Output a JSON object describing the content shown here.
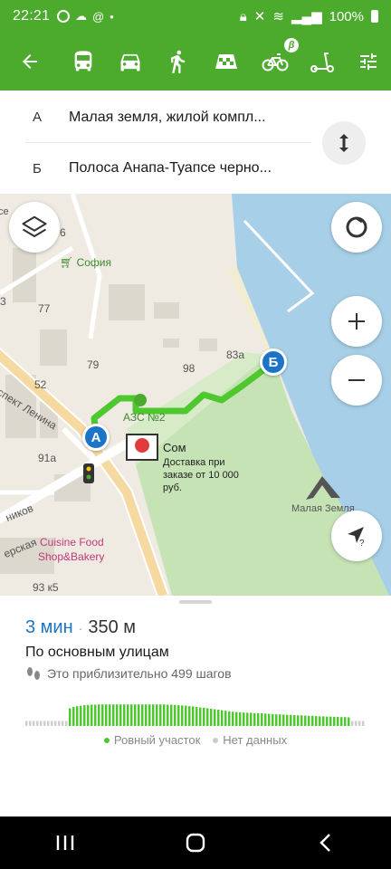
{
  "status_bar": {
    "time": "22:21",
    "battery": "100%"
  },
  "modes": [
    {
      "name": "car-mode-back",
      "icon": "back-arrow-icon"
    },
    {
      "name": "bus-mode",
      "icon": "bus-icon"
    },
    {
      "name": "car-mode",
      "icon": "car-icon"
    },
    {
      "name": "walk-mode",
      "icon": "walk-icon"
    },
    {
      "name": "taxi-mode",
      "icon": "taxi-icon"
    },
    {
      "name": "bike-mode",
      "icon": "bike-icon"
    },
    {
      "name": "scooter-mode",
      "icon": "scooter-icon"
    },
    {
      "name": "settings",
      "icon": "sliders-icon"
    }
  ],
  "colors": {
    "brand": "#4caa2c",
    "route": "#4fc72e",
    "pin": "#1b74c8",
    "water": "#a7d0e8"
  },
  "route": {
    "from_letter": "А",
    "from_address": "Малая земля, жилой компл...",
    "to_letter": "Б",
    "to_address": "Полоса Анапа-Туапсе черно..."
  },
  "map": {
    "labels": {
      "sofia": "София",
      "n77": "77",
      "n79": "79",
      "n98": "98",
      "n83a": "83а",
      "n52": "52",
      "n91a": "91а",
      "n3": "3",
      "n6": "6",
      "street_lenina": "спект Ленина",
      "azs": "АЗС №2",
      "som_title": "Сом",
      "som_desc_1": "Доставка при",
      "som_desc_2": "заказе от 10 000",
      "som_desc_3": "руб.",
      "cuisine_1": "Cuisine Food",
      "cuisine_2": "Shop&Bakery",
      "malaya_zemlya": "Малая Земля",
      "n93k5": "93 к5",
      "nikov": "ников",
      "erskaya": "ерская",
      "se": "се"
    },
    "pin_a": "А",
    "pin_b": "Б"
  },
  "summary": {
    "time": "3 мин",
    "separator": "·",
    "distance": "350 м",
    "route_type": "По основным улицам",
    "steps": "Это приблизительно 499 шагов"
  },
  "elevation": {
    "bars": [
      0.2,
      0.2,
      0.2,
      0.2,
      0.2,
      0.2,
      0.2,
      0.2,
      0.2,
      0.2,
      0.2,
      0.2,
      0.7,
      0.75,
      0.78,
      0.8,
      0.82,
      0.83,
      0.84,
      0.84,
      0.85,
      0.85,
      0.85,
      0.85,
      0.85,
      0.85,
      0.85,
      0.85,
      0.85,
      0.85,
      0.85,
      0.85,
      0.85,
      0.85,
      0.85,
      0.85,
      0.85,
      0.85,
      0.85,
      0.84,
      0.84,
      0.83,
      0.82,
      0.81,
      0.8,
      0.78,
      0.77,
      0.75,
      0.73,
      0.72,
      0.7,
      0.68,
      0.66,
      0.64,
      0.62,
      0.6,
      0.58,
      0.56,
      0.55,
      0.54,
      0.53,
      0.52,
      0.52,
      0.51,
      0.5,
      0.5,
      0.49,
      0.48,
      0.47,
      0.46,
      0.46,
      0.45,
      0.44,
      0.44,
      0.43,
      0.42,
      0.42,
      0.41,
      0.4,
      0.4,
      0.39,
      0.38,
      0.38,
      0.37,
      0.37,
      0.36,
      0.36,
      0.35,
      0.35,
      0.34,
      0.2,
      0.2,
      0.2,
      0.2
    ],
    "legend_flat": "Ровный участок",
    "legend_nodata": "Нет данных"
  }
}
